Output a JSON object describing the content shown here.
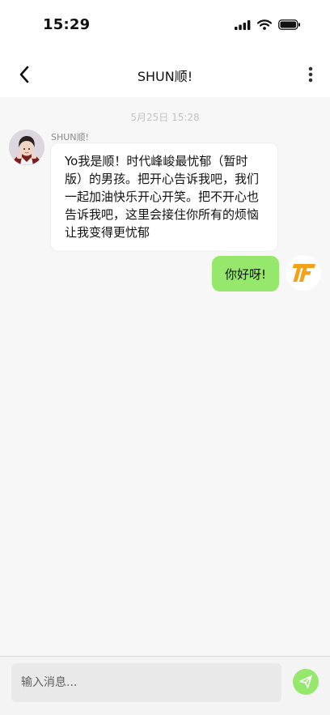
{
  "status_bar": {
    "time": "15:29"
  },
  "header": {
    "title": "SHUN顺!"
  },
  "chat": {
    "timestamp": "5月25日 15:28",
    "messages": [
      {
        "sender": "SHUN顺!",
        "text": "Yo我是顺！时代峰峻最忧郁（暂时版）的男孩。把开心告诉我吧，我们一起加油快乐开心开笑。把不开心也告诉我吧，这里会接住你所有的烦恼让我变得更忧郁"
      },
      {
        "text": "你好呀!",
        "avatar_logo": "TF"
      }
    ]
  },
  "input": {
    "placeholder": "输入消息..."
  },
  "colors": {
    "outgoing_bubble": "#95e86b",
    "send_button": "#95e86b",
    "logo": "#f2a21b"
  }
}
